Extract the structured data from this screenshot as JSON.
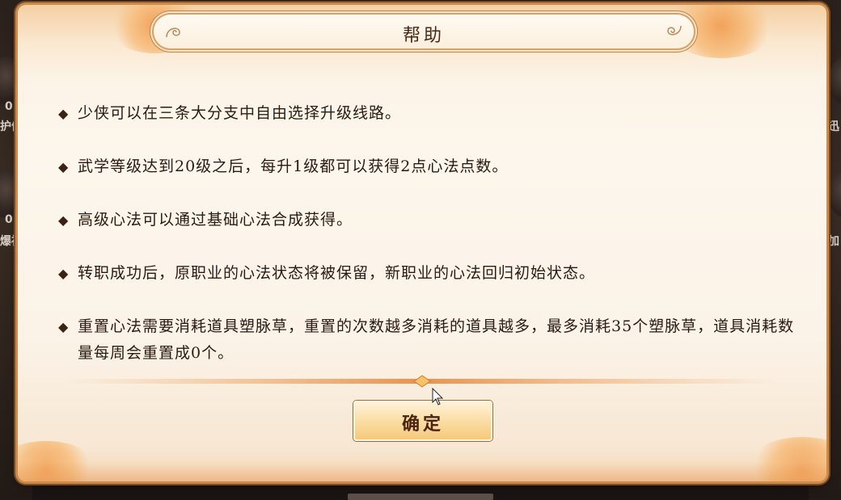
{
  "dialog": {
    "title": "帮助",
    "bullet_glyph": "◆",
    "lines": [
      "少侠可以在三条大分支中自由选择升级线路。",
      "武学等级达到20级之后，每升1级都可以获得2点心法点数。",
      "高级心法可以通过基础心法合成获得。",
      "转职成功后，原职业的心法状态将被保留，新职业的心法回归初始状态。",
      "重置心法需要消耗道具塑脉草，重置的次数越多消耗的道具越多，最多消耗35个塑脉草，道具消耗数量每周会重置成0个。"
    ],
    "confirm_label": "确定"
  },
  "background": {
    "left_labels": [
      "0",
      "护体",
      "0",
      "爆袖"
    ],
    "right_labels": [
      "迅",
      "加"
    ]
  },
  "colors": {
    "frame": "#c98a4a",
    "parchment": "#fdf6ec",
    "text": "#2b1a10",
    "accent_cloud": "#f2a35a"
  },
  "icons": {
    "bullet": "diamond-bullet-icon",
    "cursor": "mouse-pointer-icon",
    "title_ornament": "swirl-ornament-icon"
  }
}
